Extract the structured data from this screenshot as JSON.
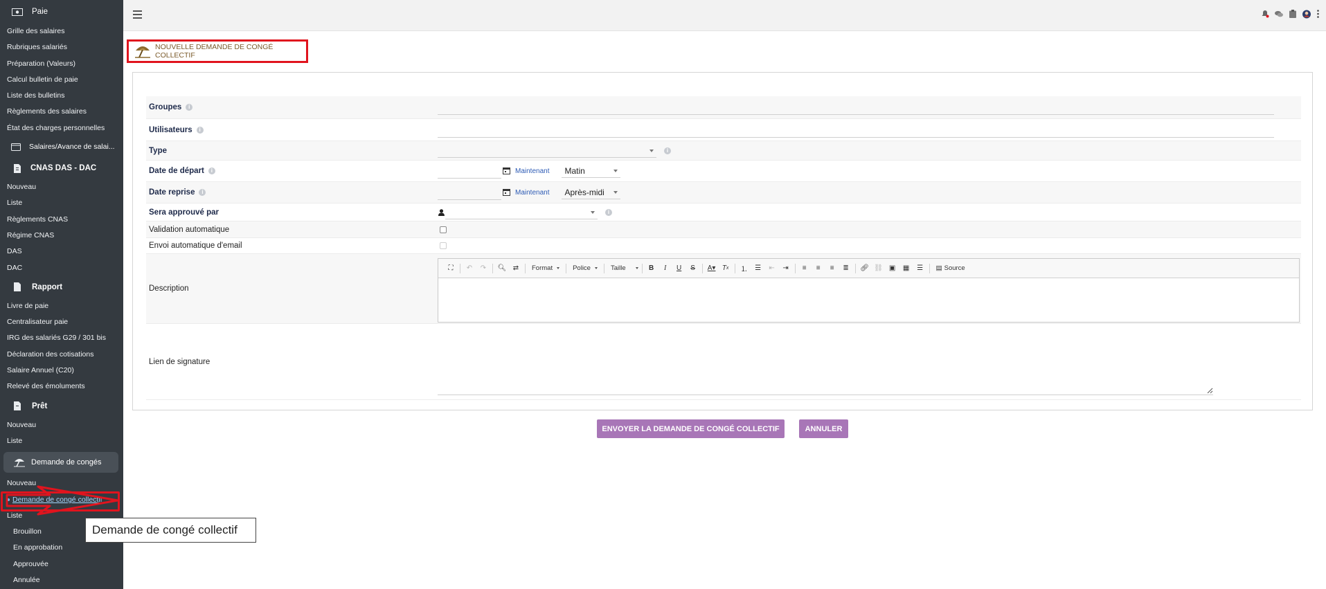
{
  "sidebar": {
    "paie": {
      "heading": "Paie",
      "items": [
        "Grille des salaires",
        "Rubriques salariés",
        "Préparation (Valeurs)",
        "Calcul bulletin de paie",
        "Liste des bulletins",
        "Règlements des salaires",
        "État des charges personnelles"
      ]
    },
    "salaires_heading": "Salaires/Avance de salai...",
    "cnas": {
      "heading": "CNAS DAS - DAC",
      "items": [
        "Nouveau",
        "Liste",
        "Règlements CNAS",
        "Régime CNAS",
        "DAS",
        "DAC"
      ]
    },
    "rapport": {
      "heading": "Rapport",
      "items": [
        "Livre de paie",
        "Centralisateur paie",
        "IRG des salariés G29 / 301 bis",
        "Déclaration des cotisations",
        "Salaire Annuel (C20)",
        "Relevé des émoluments"
      ]
    },
    "pret": {
      "heading": "Prêt",
      "items": [
        "Nouveau",
        "Liste"
      ]
    },
    "conges": {
      "heading": "Demande de congés",
      "nouveau": "Nouveau",
      "active": "Demande de congé collectif",
      "liste": "Liste",
      "sub_items": [
        "Brouillon",
        "En approbation",
        "Approuvée",
        "Annulée"
      ]
    }
  },
  "page": {
    "title": "NOUVELLE DEMANDE DE CONGÉ COLLECTIF"
  },
  "form": {
    "groupes_label": "Groupes",
    "utilisateurs_label": "Utilisateurs",
    "type_label": "Type",
    "type_value": "",
    "date_depart_label": "Date de départ",
    "date_depart_value": "",
    "date_depart_now": "Maintenant",
    "date_depart_period": "Matin",
    "date_reprise_label": "Date reprise",
    "date_reprise_value": "",
    "date_reprise_now": "Maintenant",
    "date_reprise_period": "Après-midi",
    "approuve_label": "Sera approuvé par",
    "approuve_value": "",
    "validation_label": "Validation automatique",
    "envoi_label": "Envoi automatique d'email",
    "description_label": "Description",
    "signature_label": "Lien de signature"
  },
  "editor": {
    "format": "Format",
    "police": "Police",
    "taille": "Taille",
    "source": "Source"
  },
  "buttons": {
    "submit": "ENVOYER LA DEMANDE DE CONGÉ COLLECTIF",
    "cancel": "ANNULER"
  },
  "tooltip": "Demande de congé collectif",
  "colors": {
    "sidebar_bg": "#343a40",
    "accent_button": "#a876b7",
    "highlight_red": "#e0141e",
    "title_text": "#7a5a2a"
  }
}
